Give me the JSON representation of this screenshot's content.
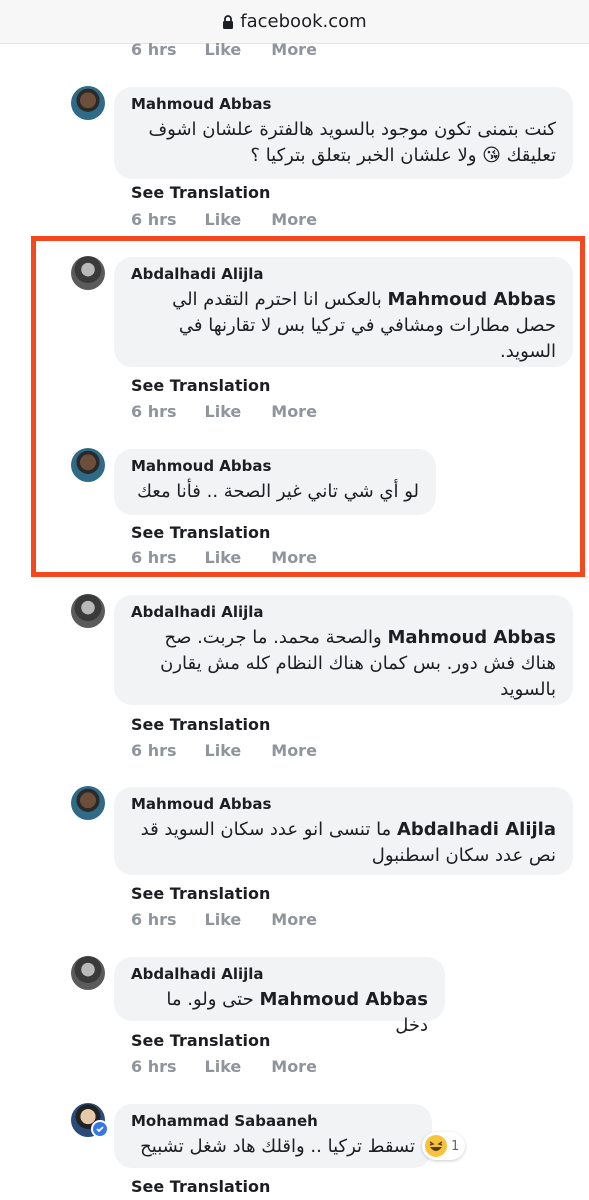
{
  "browser": {
    "url": "facebook.com"
  },
  "actions_labels": {
    "time": "6 hrs",
    "like": "Like",
    "more": "More",
    "see_translation": "See Translation"
  },
  "comments": [
    {
      "author": "Mahmoud Abbas",
      "lines": [
        "كنت بتمنى تكون موجود بالسويد هالفترة علشان اشوف",
        "تعليقك 😘 ولا علشان الخبر بتعلق بتركيا ؟"
      ],
      "time": "6 hrs"
    },
    {
      "author": "Abdalhadi Alijla",
      "mention": "Mahmoud Abbas",
      "lines": [
        "بالعكس انا احترم التقدم الي",
        "حصل مطارات ومشافي في تركيا بس لا تقارنها في",
        "السويد."
      ],
      "time": "6 hrs"
    },
    {
      "author": "Mahmoud Abbas",
      "lines": [
        "لو أي شي تاني غير الصحة .. فأنا معك"
      ],
      "time": "6 hrs"
    },
    {
      "author": "Abdalhadi Alijla",
      "mention": "Mahmoud Abbas",
      "lines": [
        "والصحة محمد. ما جربت. صح",
        "هناك فش دور. بس كمان هناك النظام كله مش يقارن",
        "بالسويد"
      ],
      "time": "6 hrs"
    },
    {
      "author": "Mahmoud Abbas",
      "mention": "Abdalhadi Alijla",
      "lines": [
        "ما تنسى انو عدد سكان السويد قد",
        "نص عدد سكان اسطنبول"
      ],
      "time": "6 hrs"
    },
    {
      "author": "Abdalhadi Alijla",
      "mention": "Mahmoud Abbas",
      "lines": [
        "حتى ولو. ما دخل"
      ],
      "time": "6 hrs"
    },
    {
      "author": "Mohammad Sabaaneh",
      "lines": [
        "تسقط تركيا .. واقلك هاد شغل تشبيح"
      ],
      "reaction_count": "1"
    }
  ],
  "colors": {
    "highlight_border": "#f4491f",
    "bubble_bg": "#f2f3f5",
    "meta_gray": "#90949c",
    "verified_blue": "#3578e5"
  }
}
